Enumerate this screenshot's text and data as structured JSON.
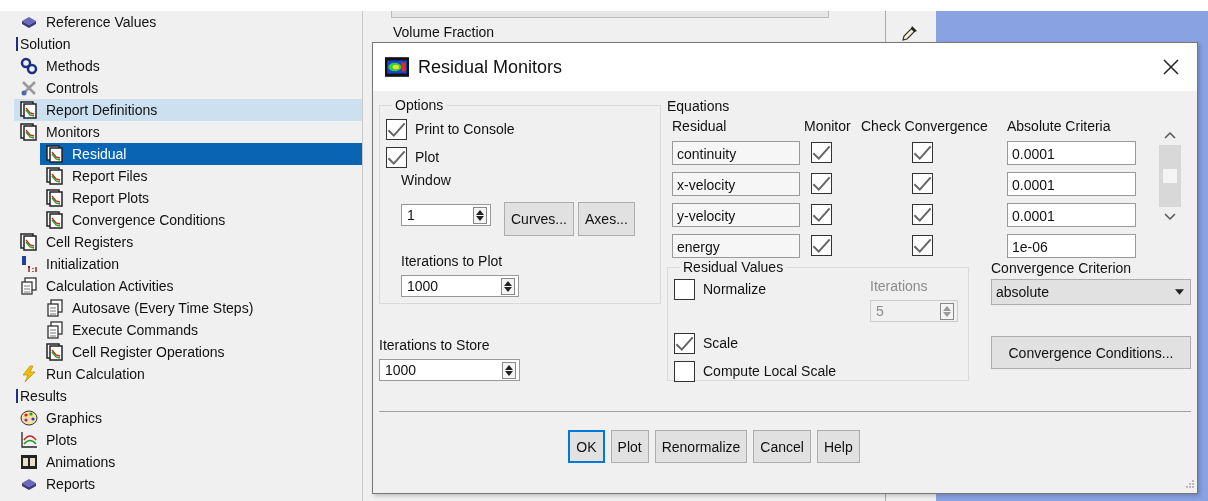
{
  "sidebar": {
    "tree": [
      {
        "kind": "book",
        "label": "Reference Values",
        "selected": false,
        "hovered": false
      },
      {
        "kind": "section",
        "label": "Solution",
        "selected": false,
        "hovered": false,
        "children": [
          {
            "kind": "gears",
            "label": "Methods",
            "selected": false,
            "hovered": false
          },
          {
            "kind": "tools",
            "label": "Controls",
            "selected": false,
            "hovered": false
          },
          {
            "kind": "report",
            "label": "Report Definitions",
            "selected": false,
            "hovered": true
          },
          {
            "kind": "report",
            "label": "Monitors",
            "selected": false,
            "hovered": false,
            "children": [
              {
                "kind": "report",
                "label": "Residual",
                "selected": true,
                "hovered": false
              },
              {
                "kind": "report",
                "label": "Report Files",
                "selected": false,
                "hovered": false
              },
              {
                "kind": "report",
                "label": "Report Plots",
                "selected": false,
                "hovered": false
              },
              {
                "kind": "report",
                "label": "Convergence Conditions",
                "selected": false,
                "hovered": false
              }
            ]
          },
          {
            "kind": "report",
            "label": "Cell Registers",
            "selected": false,
            "hovered": false
          },
          {
            "kind": "init",
            "label": "Initialization",
            "selected": false,
            "hovered": false
          },
          {
            "kind": "pages",
            "label": "Calculation Activities",
            "selected": false,
            "hovered": false,
            "children": [
              {
                "kind": "pages",
                "label": "Autosave (Every Time Steps)",
                "selected": false,
                "hovered": false
              },
              {
                "kind": "pages",
                "label": "Execute Commands",
                "selected": false,
                "hovered": false
              },
              {
                "kind": "report",
                "label": "Cell Register Operations",
                "selected": false,
                "hovered": false
              }
            ]
          },
          {
            "kind": "bolt",
            "label": "Run Calculation",
            "selected": false,
            "hovered": false
          }
        ]
      },
      {
        "kind": "section",
        "label": "Results",
        "selected": false,
        "hovered": false,
        "children": [
          {
            "kind": "palette",
            "label": "Graphics",
            "selected": false,
            "hovered": false
          },
          {
            "kind": "plot",
            "label": "Plots",
            "selected": false,
            "hovered": false
          },
          {
            "kind": "film",
            "label": "Animations",
            "selected": false,
            "hovered": false
          },
          {
            "kind": "book",
            "label": "Reports",
            "selected": false,
            "hovered": false
          }
        ]
      }
    ]
  },
  "background_panel": {
    "label": "Volume Fraction"
  },
  "dialog": {
    "title": "Residual Monitors",
    "options": {
      "title": "Options",
      "checks": [
        {
          "label": "Print to Console",
          "checked": true
        },
        {
          "label": "Plot",
          "checked": true
        }
      ],
      "window": {
        "label": "Window",
        "value": "1"
      },
      "buttons": [
        "Curves...",
        "Axes..."
      ],
      "iterations_to_plot": {
        "label": "Iterations to Plot",
        "value": "1000"
      }
    },
    "iterations_to_store": {
      "label": "Iterations to Store",
      "value": "1000"
    },
    "equations": {
      "title": "Equations",
      "columns": [
        "Residual",
        "Monitor",
        "Check Convergence",
        "Absolute Criteria"
      ],
      "rows": [
        {
          "residual": "continuity",
          "monitor": true,
          "check_convergence": true,
          "criteria": "0.0001"
        },
        {
          "residual": "x-velocity",
          "monitor": true,
          "check_convergence": true,
          "criteria": "0.0001"
        },
        {
          "residual": "y-velocity",
          "monitor": true,
          "check_convergence": true,
          "criteria": "0.0001"
        },
        {
          "residual": "energy",
          "monitor": true,
          "check_convergence": true,
          "criteria": "1e-06"
        }
      ]
    },
    "residual_values": {
      "title": "Residual Values",
      "normalize": {
        "label": "Normalize",
        "checked": false
      },
      "iterations": {
        "label": "Iterations",
        "value": "5",
        "disabled": true
      },
      "scale": {
        "label": "Scale",
        "checked": true
      },
      "compute_local_scale": {
        "label": "Compute Local Scale",
        "checked": false
      }
    },
    "convergence_criterion": {
      "label": "Convergence Criterion",
      "value": "absolute"
    },
    "convergence_conditions_button": "Convergence Conditions...",
    "footer_buttons": [
      {
        "label": "OK",
        "default": true
      },
      {
        "label": "Plot",
        "default": false
      },
      {
        "label": "Renormalize",
        "default": false
      },
      {
        "label": "Cancel",
        "default": false
      },
      {
        "label": "Help",
        "default": false
      }
    ]
  }
}
